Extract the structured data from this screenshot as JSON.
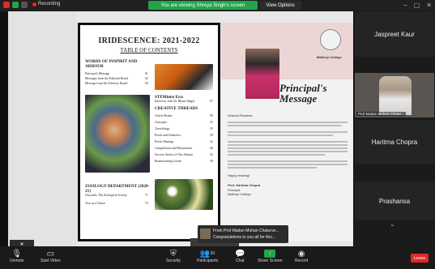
{
  "topbar": {
    "recording_label": "Recording",
    "share_banner": "You are viewing Shreya Singh's screen",
    "view_options": "View Options"
  },
  "document": {
    "title": "IRIDESCENCE: 2021-2022",
    "subtitle": "TABLE OF CONTENTS",
    "sections": [
      {
        "heading": "WORDS OF INSPIRIT AND ARDOUR",
        "entries": [
          {
            "label": "Principal's Message",
            "page": "01"
          },
          {
            "label": "Messages from the Editorial Board",
            "page": "02"
          },
          {
            "label": "Message from the Advisory Board",
            "page": "04"
          }
        ]
      },
      {
        "heading": "STEMinist Era:",
        "entries": [
          {
            "label": "Interview with Dr. Bharti Singal",
            "page": "07"
          }
        ]
      },
      {
        "heading": "CREATIVE THREADS",
        "entries": [
          {
            "label": "Article Realm",
            "page": "09"
          },
          {
            "label": "Artscapes",
            "page": "25"
          },
          {
            "label": "Travelology",
            "page": "35"
          },
          {
            "label": "Pixels and Aesthetics",
            "page": "39"
          },
          {
            "label": "Poetic Musings",
            "page": "42"
          },
          {
            "label": "Compilations and Illustrations",
            "page": "48"
          },
          {
            "label": "Success Stories of Our Alumni",
            "page": "52"
          },
          {
            "label": "Brainstorming Corner",
            "page": "58"
          }
        ]
      },
      {
        "heading": "ZOOLOGY DEPARTMENT (2020-21)",
        "entries": [
          {
            "label": "Chrysalis, The Zoological Society",
            "page": "71"
          },
          {
            "label": "Year at a Glance",
            "page": "73"
          }
        ]
      }
    ]
  },
  "message_page": {
    "title": "Principal's Message",
    "greeting": "Dearest Readers,",
    "closing": "Happy reading!",
    "signature_name": "Prof. Haritma Chopra",
    "signature_role": "Principal",
    "signature_college": "Maitreyi College",
    "college_name": "Maitreyi College"
  },
  "pdf_controls": {
    "page": "2",
    "total": "/ 1"
  },
  "participants": [
    {
      "name": "Jaspreet Kaur",
      "video": false
    },
    {
      "name": "Prof Madan Mohan Chatur...",
      "video": true
    },
    {
      "name": "Haritma Chopra",
      "video": false
    },
    {
      "name": "Prashansa",
      "video": false
    }
  ],
  "chat_toast": {
    "from": "From Prof Madan Mohan Chaturve...",
    "message": "Congratulations to you all for this..."
  },
  "toolbar": {
    "unmute": "Unmute",
    "start_video": "Start Video",
    "security": "Security",
    "participants": "Participants",
    "participants_count": "81",
    "chat": "Chat",
    "share_screen": "Share Screen",
    "record": "Record",
    "leave": "Leave"
  },
  "colors": {
    "accent_green": "#22a54a",
    "leave_red": "#e02828"
  }
}
